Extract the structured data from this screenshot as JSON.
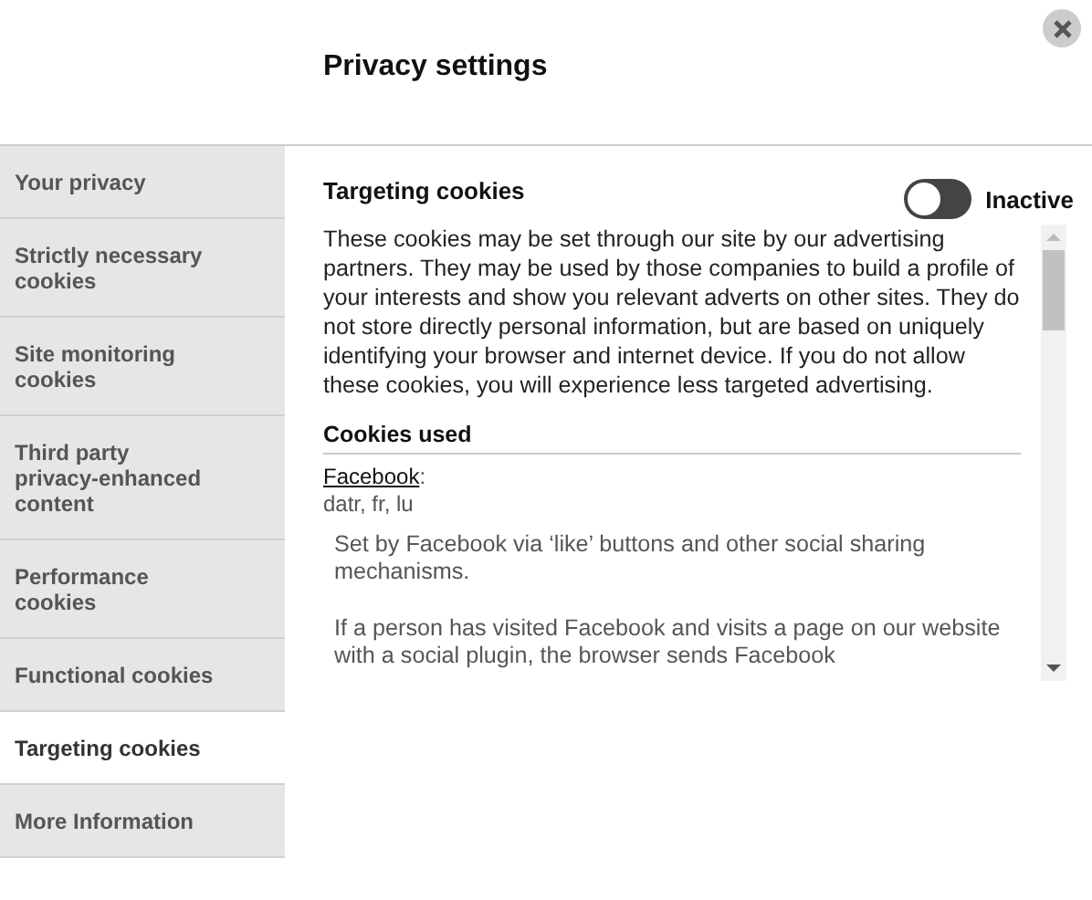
{
  "title": "Privacy settings",
  "sidebar": {
    "items": [
      {
        "label": "Your privacy",
        "selected": false
      },
      {
        "label": "Strictly necessary cookies",
        "selected": false
      },
      {
        "label": "Site monitoring cookies",
        "selected": false
      },
      {
        "label": "Third party privacy-enhanced content",
        "selected": false
      },
      {
        "label": "Performance cookies",
        "selected": false
      },
      {
        "label": "Functional cookies",
        "selected": false
      },
      {
        "label": "Targeting cookies",
        "selected": true
      },
      {
        "label": "More Information",
        "selected": false
      }
    ]
  },
  "section": {
    "heading": "Targeting cookies",
    "toggle": {
      "on": false,
      "label": "Inactive"
    },
    "description": "These cookies may be set through our site by our advertising partners. They may be used by those companies to build a profile of your interests and show you relevant adverts on other sites. They do not store directly personal information, but are based on uniquely identifying your browser and internet device. If you do not allow these cookies, you will experience less targeted advertising.",
    "cookies_heading": "Cookies used",
    "cookies": [
      {
        "provider": "Facebook",
        "colon": ":",
        "names": "datr, fr, lu",
        "details": [
          "Set by Facebook via ‘like’ buttons and other social sharing mechanisms.",
          "If a person has visited Facebook and visits a page on our website with a social plugin, the browser sends Facebook"
        ]
      }
    ]
  }
}
